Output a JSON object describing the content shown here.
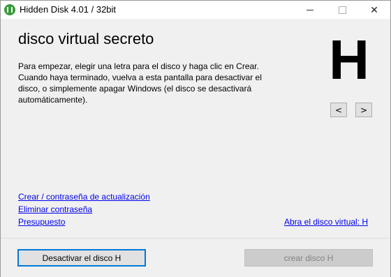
{
  "window": {
    "title": "Hidden Disk 4.01 / 32bit",
    "controls": {
      "minimize": "minimize-icon",
      "maximize": "maximize-icon",
      "close": "close-icon"
    }
  },
  "main": {
    "heading": "disco virtual secreto",
    "description": "Para empezar, elegir una letra para el disco y haga clic en Crear. Cuando haya terminado, vuelva a esta pantalla para desactivar el disco, o simplemente apagar Windows (el disco se desactivará automáticamente).",
    "drive_letter": "H",
    "prev_label": "<",
    "next_label": ">"
  },
  "links": {
    "create_password": "Crear / contraseña de actualización",
    "delete_password": "Eliminar contraseña",
    "budget": "Presupuesto",
    "open_disk": "Abra el disco virtual: H"
  },
  "footer": {
    "deactivate_label": "Desactivar el disco H",
    "create_label": "crear disco H"
  },
  "colors": {
    "link": "#0000ee",
    "focus_border": "#0078d7",
    "app_icon": "#3a9a3a"
  }
}
